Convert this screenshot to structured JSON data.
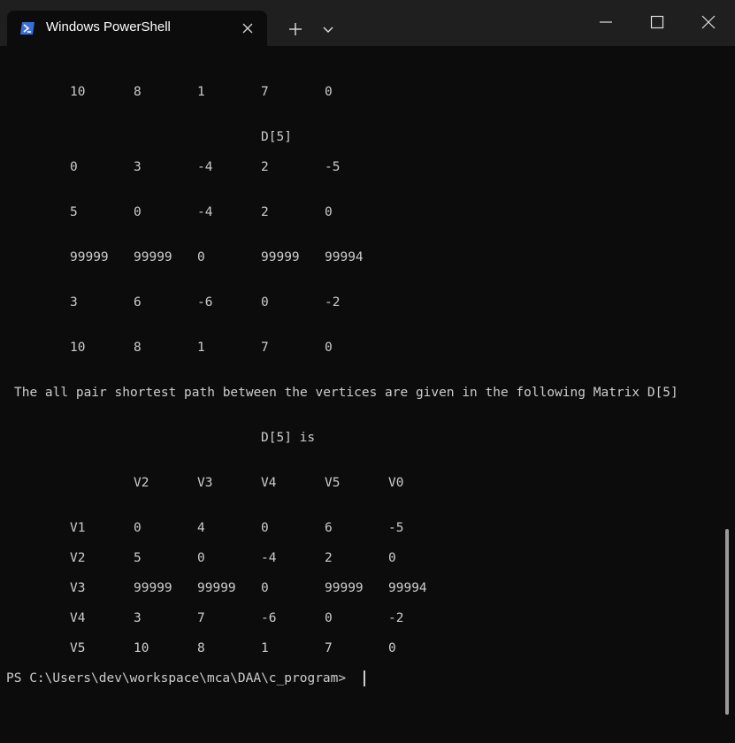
{
  "window": {
    "tab_title": "Windows PowerShell"
  },
  "icons": {
    "tab_icon": "powershell-icon",
    "tab_close": "close-icon",
    "new_tab": "plus-icon",
    "dropdown": "chevron-down-icon",
    "minimize": "minimize-icon",
    "maximize": "maximize-icon",
    "close": "close-icon"
  },
  "console": {
    "row_first": [
      "10",
      "8",
      "1",
      "7",
      "0"
    ],
    "matrix_title": "D[5]",
    "matrix_rows": [
      [
        "0",
        "3",
        "-4",
        "2",
        "-5"
      ],
      [
        "5",
        "0",
        "-4",
        "2",
        "0"
      ],
      [
        "99999",
        "99999",
        "0",
        "99999",
        "99994"
      ],
      [
        "3",
        "6",
        "-6",
        "0",
        "-2"
      ],
      [
        "10",
        "8",
        "1",
        "7",
        "0"
      ]
    ],
    "summary_line": "The all pair shortest path between the vertices are given in the following Matrix D[5]",
    "result_title": "D[5] is",
    "header_cols": [
      "V2",
      "V3",
      "V4",
      "V5",
      "V0"
    ],
    "result_rows": [
      {
        "label": "V1",
        "values": [
          "0",
          "4",
          "0",
          "6",
          "-5"
        ]
      },
      {
        "label": "V2",
        "values": [
          "5",
          "0",
          "-4",
          "2",
          "0"
        ]
      },
      {
        "label": "V3",
        "values": [
          "99999",
          "99999",
          "0",
          "99999",
          "99994"
        ]
      },
      {
        "label": "V4",
        "values": [
          "3",
          "7",
          "-6",
          "0",
          "-2"
        ]
      },
      {
        "label": "V5",
        "values": [
          "10",
          "8",
          "1",
          "7",
          "0"
        ]
      }
    ],
    "prompt": "PS C:\\Users\\dev\\workspace\\mca\\DAA\\c_program> "
  },
  "colors": {
    "background": "#0c0c0c",
    "titlebar": "#1f1f1f",
    "text": "#cccccc",
    "accent": "#3a6fd8"
  }
}
